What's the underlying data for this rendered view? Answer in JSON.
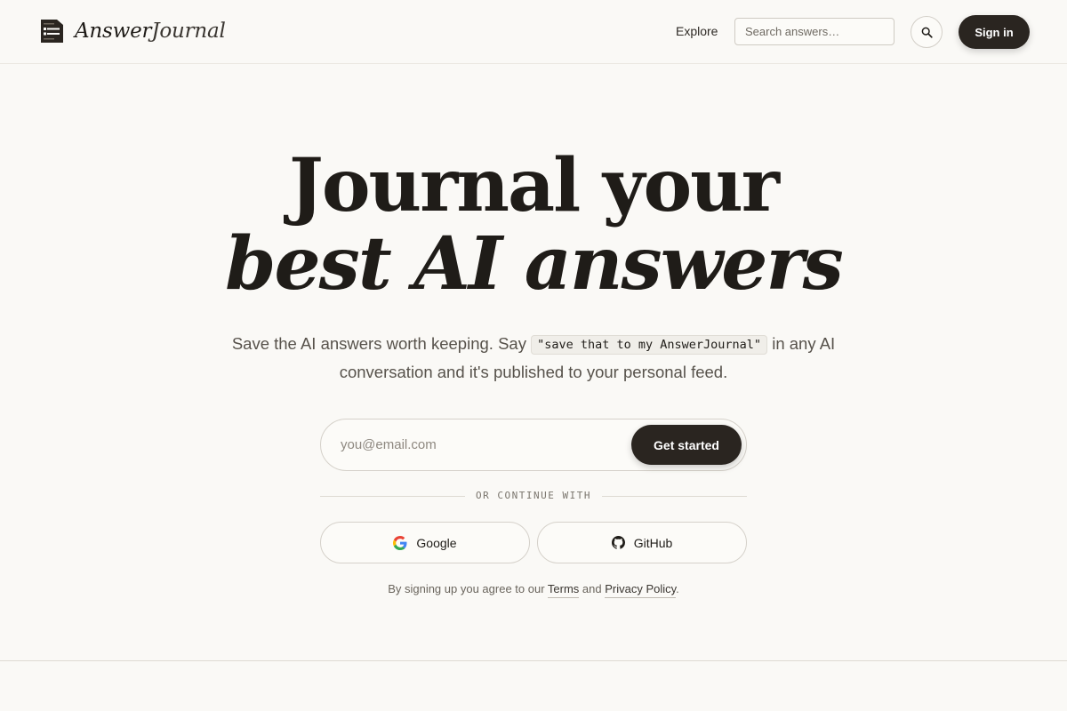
{
  "header": {
    "brand_bold": "Answer",
    "brand_light": "Journal",
    "nav_explore": "Explore",
    "search_placeholder": "Search answers…",
    "signin_label": "Sign in"
  },
  "hero": {
    "title_line1": "Journal your",
    "title_line2": "best AI answers",
    "subtitle_before": "Save the AI answers worth keeping. Say ",
    "subtitle_code": "\"save that to my AnswerJournal\"",
    "subtitle_after": " in any AI conversation and it's published to your personal feed."
  },
  "signup": {
    "email_placeholder": "you@email.com",
    "email_value": "",
    "cta_label": "Get started",
    "divider_text": "OR CONTINUE WITH",
    "google_label": "Google",
    "github_label": "GitHub"
  },
  "legal": {
    "prefix": "By signing up you agree to our ",
    "terms_label": "Terms",
    "and_text": " and ",
    "privacy_label": "Privacy Policy",
    "suffix": "."
  },
  "icons": {
    "logo": "journal-logo-icon",
    "search": "search-icon",
    "google": "google-icon",
    "github": "github-icon"
  },
  "colors": {
    "background": "#faf9f6",
    "text": "#1f1c18",
    "button_dark": "#2a2520",
    "border": "#d5d1ca",
    "muted_text": "#57524b"
  }
}
